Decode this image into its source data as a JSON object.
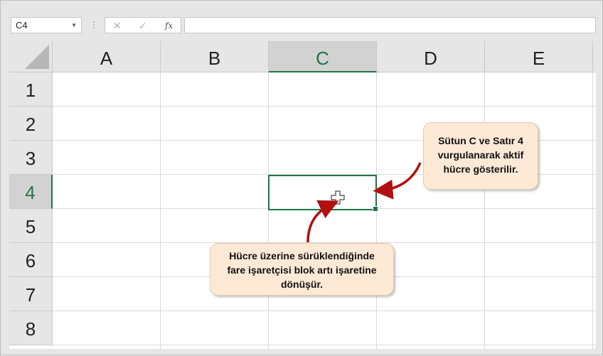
{
  "formula_bar": {
    "name_box": "C4",
    "cancel_icon": "✕",
    "enter_icon": "✓",
    "fx_label": "fx",
    "formula_value": ""
  },
  "grid": {
    "columns": [
      "A",
      "B",
      "C",
      "D",
      "E"
    ],
    "rows": [
      "1",
      "2",
      "3",
      "4",
      "5",
      "6",
      "7",
      "8"
    ],
    "active_column": "C",
    "active_row": "4"
  },
  "callouts": {
    "top_right": [
      "Sütun C ve Satır 4",
      "vurgulanarak aktif",
      "hücre gösterilir."
    ],
    "bottom": [
      "Hücre üzerine sürüklendiğinde",
      "fare işaretçisi blok artı işaretine",
      "dönüşür."
    ]
  },
  "colors": {
    "accent": "#217346",
    "arrow": "#b01010",
    "callout_bg": "#fde9d6",
    "header_bg": "#e6e6e6"
  },
  "icons": {
    "pointer": "block-plus-cursor-icon"
  }
}
